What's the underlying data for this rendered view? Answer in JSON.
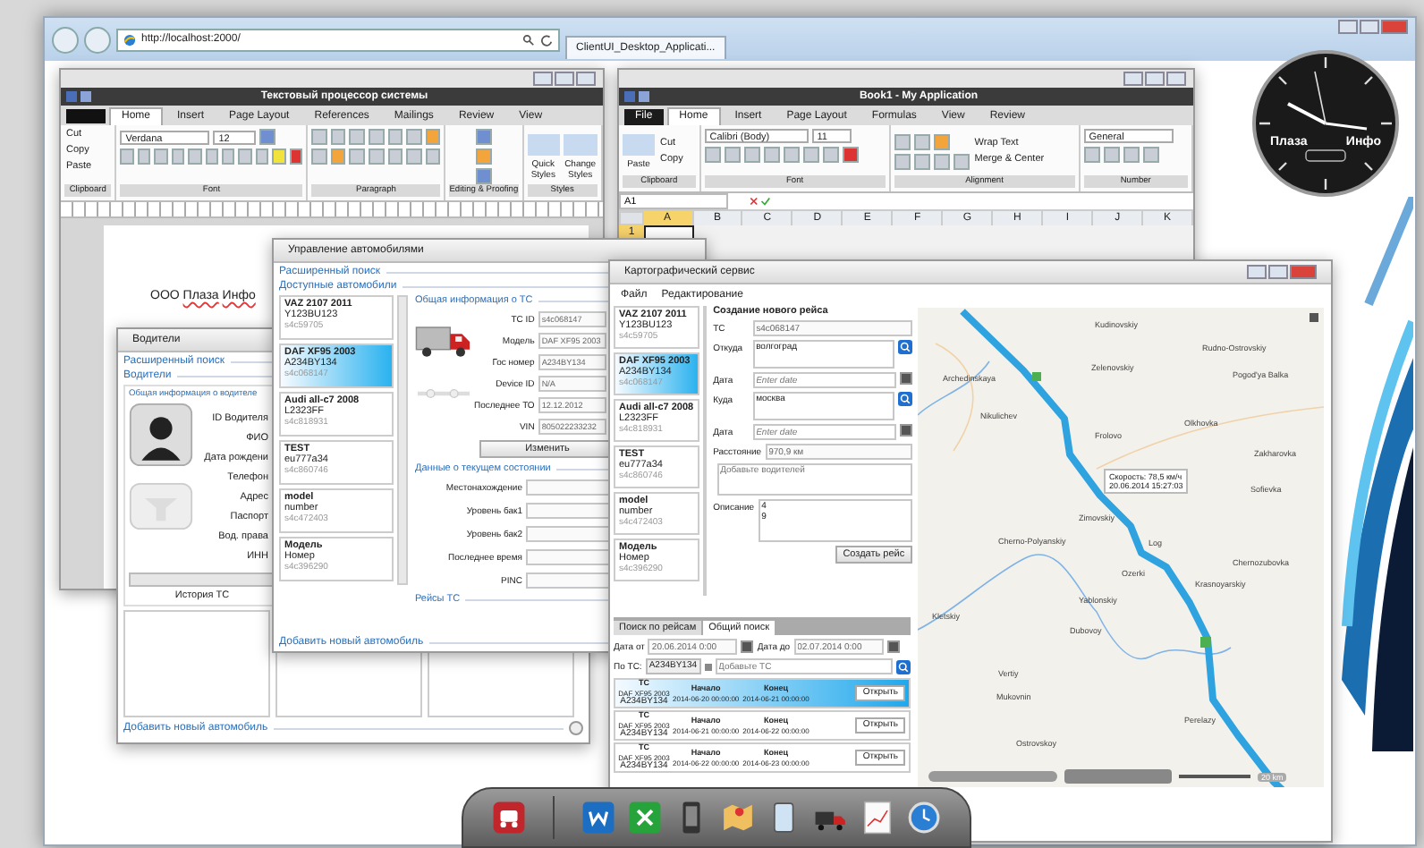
{
  "browser": {
    "url": "http://localhost:2000/",
    "tab": "ClientUI_Desktop_Applicati..."
  },
  "word": {
    "title": "Текстовый процессор системы",
    "tabs": [
      {
        "label": "Home",
        "selected": true
      },
      {
        "label": "Insert",
        "selected": false
      },
      {
        "label": "Page Layout",
        "selected": false
      },
      {
        "label": "References",
        "selected": false
      },
      {
        "label": "Mailings",
        "selected": false
      },
      {
        "label": "Review",
        "selected": false
      },
      {
        "label": "View",
        "selected": false
      }
    ],
    "clipboard": [
      "Cut",
      "Copy",
      "Paste"
    ],
    "font": "Verdana",
    "size": "12",
    "styles": [
      "Quick Styles",
      "Change Styles"
    ],
    "groups": [
      "Clipboard",
      "Font",
      "Paragraph",
      "Editing & Proofing",
      "Styles"
    ],
    "document_words": [
      {
        "text": "ООО",
        "misspelled": false
      },
      {
        "text": "Плаза",
        "misspelled": true
      },
      {
        "text": "Инфо",
        "misspelled": true
      }
    ]
  },
  "excel": {
    "title": "Book1 - My Application",
    "tabs": [
      {
        "label": "File",
        "selected": false
      },
      {
        "label": "Home",
        "selected": true
      },
      {
        "label": "Insert",
        "selected": false
      },
      {
        "label": "Page Layout",
        "selected": false
      },
      {
        "label": "Formulas",
        "selected": false
      },
      {
        "label": "View",
        "selected": false
      },
      {
        "label": "Review",
        "selected": false
      }
    ],
    "clipboard": [
      "Paste",
      "Cut",
      "Copy"
    ],
    "font": "Calibri (Body)",
    "size": "11",
    "wrap": "Wrap Text",
    "merge": "Merge & Center",
    "number_format": "General",
    "groups": [
      "Clipboard",
      "Font",
      "Alignment",
      "Number"
    ],
    "name_box": "A1",
    "columns": [
      {
        "label": "A",
        "selected": true
      },
      {
        "label": "B",
        "selected": false
      },
      {
        "label": "C",
        "selected": false
      },
      {
        "label": "D",
        "selected": false
      },
      {
        "label": "E",
        "selected": false
      },
      {
        "label": "F",
        "selected": false
      },
      {
        "label": "G",
        "selected": false
      },
      {
        "label": "H",
        "selected": false
      },
      {
        "label": "I",
        "selected": false
      },
      {
        "label": "J",
        "selected": false
      },
      {
        "label": "K",
        "selected": false
      }
    ],
    "rows": [
      {
        "label": "1",
        "selected": true
      }
    ]
  },
  "clock": {
    "brand": [
      "Плаза",
      "Инфо"
    ]
  },
  "drivers": {
    "title": "Водители",
    "search": "Расширенный поиск",
    "list": "Водители",
    "section": "Общая информация о водителе",
    "fields": [
      "ID Водителя",
      "ФИО",
      "Дата рождени",
      "Телефон",
      "Адрес",
      "Паспорт",
      "Вод. права",
      "ИНН"
    ],
    "history": "История ТС",
    "footer": "Добавить новый автомобиль"
  },
  "cars": {
    "title": "Управление автомобилями",
    "search": "Расширенный поиск",
    "available": "Доступные автомобили",
    "vehicles": [
      {
        "model": "VAZ 2107 2011",
        "plate": "Y123BU123",
        "id": "s4c59705",
        "selected": false
      },
      {
        "model": "DAF XF95 2003",
        "plate": "A234BY134",
        "id": "s4c068147",
        "selected": true
      },
      {
        "model": "Audi all-c7 2008",
        "plate": "L2323FF",
        "id": "s4c818931",
        "selected": false
      },
      {
        "model": "TEST",
        "plate": "eu777a34",
        "id": "s4c860746",
        "selected": false
      },
      {
        "model": "model",
        "plate": "number",
        "id": "s4c472403",
        "selected": false
      },
      {
        "model": "Модель",
        "plate": "Номер",
        "id": "s4c396290",
        "selected": false
      }
    ],
    "info_title": "Общая информация о ТС",
    "info": [
      {
        "label": "ТС ID",
        "value": "s4c068147"
      },
      {
        "label": "Модель",
        "value": "DAF XF95 2003"
      },
      {
        "label": "Гос номер",
        "value": "A234BY134"
      },
      {
        "label": "Device ID",
        "value": "N/A"
      },
      {
        "label": "Последнее ТО",
        "value": "12.12.2012"
      },
      {
        "label": "VIN",
        "value": "805022233232"
      }
    ],
    "edit": "Изменить",
    "state_title": "Данные о текущем состоянии",
    "state": [
      "Местонахождение",
      "Уровень бак1",
      "Уровень бак2",
      "Последнее время",
      "PINC"
    ],
    "trips": "Рейсы ТС",
    "footer": "Добавить новый автомобиль"
  },
  "map_service": {
    "title": "Картографический сервис",
    "menu": [
      "Файл",
      "Редактирование"
    ],
    "vehicles": [
      {
        "model": "VAZ 2107 2011",
        "plate": "Y123BU123",
        "id": "s4c59705",
        "selected": false
      },
      {
        "model": "DAF XF95 2003",
        "plate": "A234BY134",
        "id": "s4c068147",
        "selected": true
      },
      {
        "model": "Audi all-c7 2008",
        "plate": "L2323FF",
        "id": "s4c818931",
        "selected": false
      },
      {
        "model": "TEST",
        "plate": "eu777a34",
        "id": "s4c860746",
        "selected": false
      },
      {
        "model": "model",
        "plate": "number",
        "id": "s4c472403",
        "selected": false
      },
      {
        "model": "Модель",
        "plate": "Номер",
        "id": "s4c396290",
        "selected": false
      }
    ],
    "form": {
      "title": "Создание нового рейса",
      "fields": [
        {
          "label": "ТС",
          "value": "s4c068147",
          "kind": "readonly"
        },
        {
          "label": "Откуда",
          "value": "волгоград",
          "kind": "place"
        },
        {
          "label": "Дата",
          "placeholder": "Enter date",
          "kind": "date"
        },
        {
          "label": "Куда",
          "value": "москва",
          "kind": "place"
        },
        {
          "label": "Дата",
          "placeholder": "Enter date",
          "kind": "date"
        },
        {
          "label": "Расстояние",
          "value": "970,9 км",
          "kind": "readonly"
        }
      ],
      "drivers_placeholder": "Добавьте водителей",
      "description_label": "Описание",
      "description": [
        "4",
        "9"
      ],
      "submit": "Создать рейс"
    },
    "search_tabs": [
      {
        "label": "Поиск по рейсам",
        "selected": false
      },
      {
        "label": "Общий поиск",
        "selected": true
      }
    ],
    "date_from_label": "Дата от",
    "date_from": "20.06.2014 0:00",
    "date_to_label": "Дата до",
    "date_to": "02.07.2014 0:00",
    "vehicle_label": "По ТС:",
    "vehicle_tag": "A234BY134",
    "vehicle_placeholder": "Добавьте ТС",
    "results": [
      {
        "vehicle_label": "ТС",
        "model": "DAF XF95 2003",
        "plate": "A234BY134",
        "start_label": "Начало",
        "start": "2014-06-20 00:00:00",
        "end_label": "Конец",
        "end": "2014-06-21 00:00:00",
        "action": "Открыть",
        "selected": true
      },
      {
        "vehicle_label": "ТС",
        "model": "DAF XF95 2003",
        "plate": "A234BY134",
        "start_label": "Начало",
        "start": "2014-06-21 00:00:00",
        "end_label": "Конец",
        "end": "2014-06-22 00:00:00",
        "action": "Открыть",
        "selected": false
      },
      {
        "vehicle_label": "ТС",
        "model": "DAF XF95 2003",
        "plate": "A234BY134",
        "start_label": "Начало",
        "start": "2014-06-22 00:00:00",
        "end_label": "Конец",
        "end": "2014-06-23 00:00:00",
        "action": "Открыть",
        "selected": false
      }
    ],
    "map": {
      "towns": [
        "Kudinovskiy",
        "Rudno-Ostrovskiy",
        "Archedinskaya",
        "Zelenovskiy",
        "Pogod'ya Balka",
        "Nikulichev",
        "Frolovo",
        "Olkhovka",
        "Zakharovka",
        "Sofievka",
        "Zimovskiy",
        "Cherno-Polyanskiy",
        "Log",
        "Chernozubovka",
        "Ozerki",
        "Krasnoyarskiy",
        "Yablonskiy",
        "Kletskiy",
        "Dubovoy",
        "Vertiy",
        "Mukovnin",
        "Perelazy",
        "Ostrovskoy"
      ],
      "tooltip": [
        "Скорость: 78,5 км/ч",
        "20.06.2014 15:27:03"
      ],
      "scale": "20 km"
    }
  }
}
